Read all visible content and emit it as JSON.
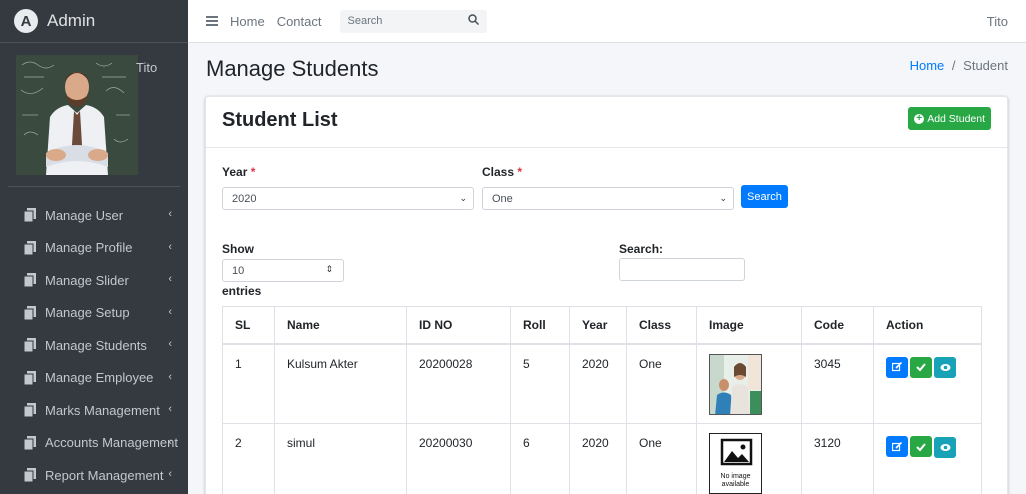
{
  "brand": {
    "logo_letter": "A",
    "title": "Admin"
  },
  "sidebar": {
    "user_name": "Tito",
    "items": [
      {
        "label": "Manage User",
        "icon": "copy-icon"
      },
      {
        "label": "Manage Profile",
        "icon": "copy-icon"
      },
      {
        "label": "Manage Slider",
        "icon": "copy-icon"
      },
      {
        "label": "Manage Setup",
        "icon": "copy-icon"
      },
      {
        "label": "Manage Students",
        "icon": "copy-icon"
      },
      {
        "label": "Manage Employee",
        "icon": "copy-icon"
      },
      {
        "label": "Marks Management",
        "icon": "copy-icon"
      },
      {
        "label": "Accounts Management",
        "icon": "copy-icon"
      },
      {
        "label": "Report Management",
        "icon": "copy-icon"
      }
    ],
    "chevron": "‹"
  },
  "topbar": {
    "home": "Home",
    "contact": "Contact",
    "search_placeholder": "Search",
    "user": "Tito"
  },
  "page": {
    "title": "Manage Students",
    "breadcrumb_home": "Home",
    "breadcrumb_sep": "/",
    "breadcrumb_current": "Student"
  },
  "card": {
    "title": "Student List",
    "add_button": "Add Student",
    "year_label": "Year",
    "year_value": "2020",
    "class_label": "Class",
    "class_value": "One",
    "required_mark": "*",
    "search_button": "Search",
    "show_label": "Show",
    "entries_value": "10",
    "entries_label": "entries",
    "search_label": "Search:"
  },
  "table": {
    "headers": [
      "SL",
      "Name",
      "ID NO",
      "Roll",
      "Year",
      "Class",
      "Image",
      "Code",
      "Action"
    ],
    "rows": [
      {
        "sl": "1",
        "name": "Kulsum Akter",
        "id_no": "20200028",
        "roll": "5",
        "year": "2020",
        "class": "One",
        "image": "student-photo",
        "code": "3045"
      },
      {
        "sl": "2",
        "name": "simul",
        "id_no": "20200030",
        "roll": "6",
        "year": "2020",
        "class": "One",
        "image": "no-image",
        "no_image_text_1": "No image",
        "no_image_text_2": "available",
        "code": "3120"
      }
    ]
  },
  "colors": {
    "sidebar_bg": "#343a40",
    "primary": "#007bff",
    "success": "#28a745",
    "info": "#17a2b8",
    "danger": "#dc3545"
  }
}
